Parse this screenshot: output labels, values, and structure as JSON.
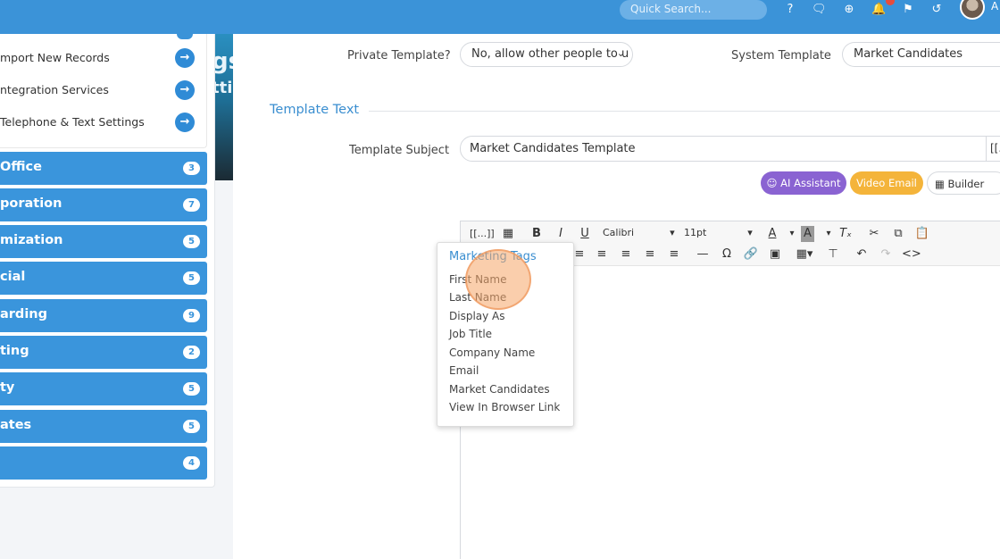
{
  "topbar": {
    "search_placeholder": "Quick Search...",
    "icons": [
      "help-icon",
      "chat-icon",
      "add-icon",
      "bell-icon",
      "flag-icon",
      "history-icon"
    ],
    "trail_text": "A",
    "accent": "#3b93d8"
  },
  "sidebar": {
    "links": [
      {
        "label": "mport New Records"
      },
      {
        "label": "ntegration Services"
      },
      {
        "label": "Telephone & Text Settings"
      }
    ],
    "categories": [
      {
        "label": "Office",
        "count": "3"
      },
      {
        "label": "poration",
        "count": "7"
      },
      {
        "label": "mization",
        "count": "5"
      },
      {
        "label": "cial",
        "count": "5"
      },
      {
        "label": "arding",
        "count": "9"
      },
      {
        "label": "ting",
        "count": "2"
      },
      {
        "label": "ty",
        "count": "5"
      },
      {
        "label": "ates",
        "count": "5"
      },
      {
        "label": "",
        "count": "4"
      }
    ],
    "banner_text_1": "gs",
    "banner_text_2": "ttir"
  },
  "form": {
    "private_label": "Private Template?",
    "private_value": "No, allow other people to u",
    "system_label": "System Template",
    "system_value": "Market Candidates",
    "section_title": "Template Text",
    "subject_label": "Template Subject",
    "subject_value": "Market Candidates Template",
    "subject_addon": "[[."
  },
  "actions": {
    "ai_label": "AI Assistant",
    "video_label": "Video Email",
    "builder_label": "Builder"
  },
  "editor": {
    "font_name": "Calibri",
    "font_size": "11pt"
  },
  "marketing_tags": {
    "title": "Marketing Tags",
    "items": [
      "First Name",
      "Last Name",
      "Display As",
      "Job Title",
      "Company Name",
      "Email",
      "Market Candidates",
      "View In Browser Link"
    ]
  }
}
